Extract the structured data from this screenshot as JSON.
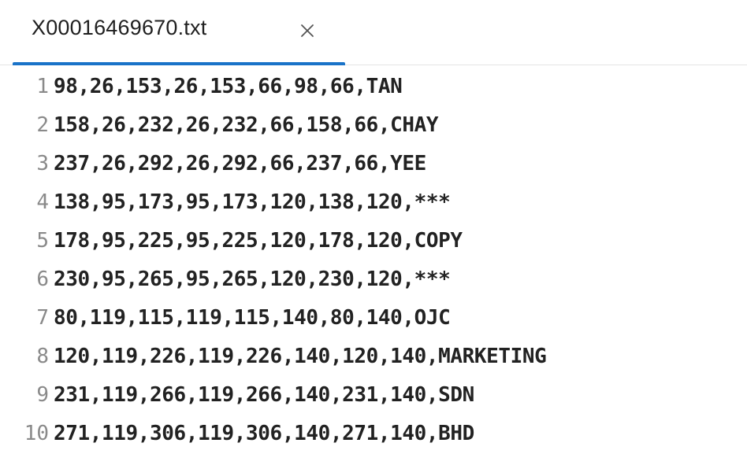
{
  "tab": {
    "title": "X00016469670.txt",
    "close_icon": "close-icon"
  },
  "colors": {
    "accent": "#1a73c8",
    "line_number": "#8a8a8a",
    "text": "#222222"
  },
  "lines": [
    {
      "number": "1",
      "text": "98,26,153,26,153,66,98,66,TAN"
    },
    {
      "number": "2",
      "text": "158,26,232,26,232,66,158,66,CHAY"
    },
    {
      "number": "3",
      "text": "237,26,292,26,292,66,237,66,YEE"
    },
    {
      "number": "4",
      "text": "138,95,173,95,173,120,138,120,***"
    },
    {
      "number": "5",
      "text": "178,95,225,95,225,120,178,120,COPY"
    },
    {
      "number": "6",
      "text": "230,95,265,95,265,120,230,120,***"
    },
    {
      "number": "7",
      "text": "80,119,115,119,115,140,80,140,OJC"
    },
    {
      "number": "8",
      "text": "120,119,226,119,226,140,120,140,MARKETING"
    },
    {
      "number": "9",
      "text": "231,119,266,119,266,140,231,140,SDN"
    },
    {
      "number": "10",
      "text": "271,119,306,119,306,140,271,140,BHD"
    }
  ]
}
